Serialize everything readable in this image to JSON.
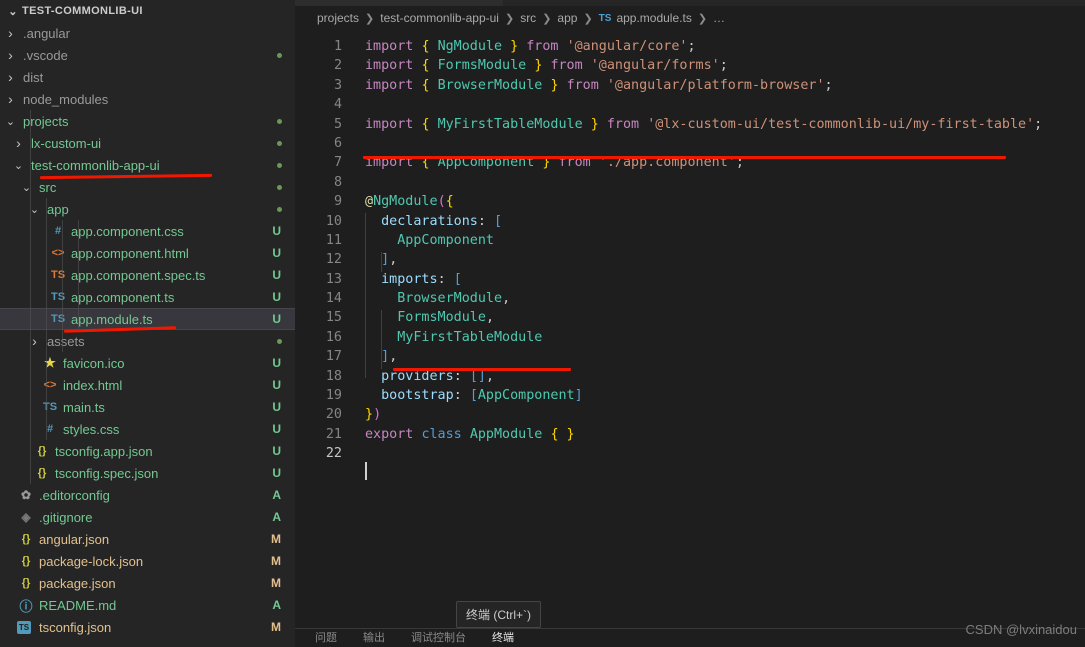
{
  "sidebar": {
    "title": "TEST-COMMONLIB-UI",
    "title_twisty": "chevron-down",
    "items": [
      {
        "label": ".angular",
        "icon": "folder",
        "twisty": "chevron-right",
        "indent": 1,
        "status": "",
        "dot": false,
        "color": "#9a9a9a"
      },
      {
        "label": ".vscode",
        "icon": "folder",
        "twisty": "chevron-right",
        "indent": 1,
        "status": "",
        "dot": true,
        "color": "#9a9a9a"
      },
      {
        "label": "dist",
        "icon": "folder",
        "twisty": "chevron-right",
        "indent": 1,
        "status": "",
        "dot": false,
        "color": "#9a9a9a"
      },
      {
        "label": "node_modules",
        "icon": "folder",
        "twisty": "chevron-right",
        "indent": 1,
        "status": "",
        "dot": false,
        "color": "#9a9a9a"
      },
      {
        "label": "projects",
        "icon": "folder",
        "twisty": "chevron-down",
        "indent": 1,
        "status": "",
        "dot": true,
        "color": "#73c991"
      },
      {
        "label": "lx-custom-ui",
        "icon": "folder",
        "twisty": "chevron-right",
        "indent": 2,
        "status": "",
        "dot": true,
        "color": "#73c991"
      },
      {
        "label": "test-commonlib-app-ui",
        "icon": "folder",
        "twisty": "chevron-down",
        "indent": 2,
        "status": "",
        "dot": true,
        "color": "#73c991"
      },
      {
        "label": "src",
        "icon": "folder",
        "twisty": "chevron-down",
        "indent": 3,
        "status": "",
        "dot": true,
        "color": "#73c991"
      },
      {
        "label": "app",
        "icon": "folder",
        "twisty": "chevron-down",
        "indent": 4,
        "status": "",
        "dot": true,
        "color": "#73c991"
      },
      {
        "label": "app.component.css",
        "icon": "css-icon",
        "icon_glyph": "#",
        "icon_color": "#519aba",
        "twisty": "none",
        "indent": 5,
        "status": "U",
        "dot": false,
        "color": "#73c991"
      },
      {
        "label": "app.component.html",
        "icon": "html-icon",
        "icon_glyph": "<>",
        "icon_color": "#e37933",
        "twisty": "none",
        "indent": 5,
        "status": "U",
        "dot": false,
        "color": "#73c991"
      },
      {
        "label": "app.component.spec.ts",
        "icon": "ts-test-icon",
        "icon_glyph": "TS",
        "icon_color": "#e37933",
        "twisty": "none",
        "indent": 5,
        "status": "U",
        "dot": false,
        "color": "#73c991"
      },
      {
        "label": "app.component.ts",
        "icon": "ts-icon",
        "icon_glyph": "TS",
        "icon_color": "#519aba",
        "twisty": "none",
        "indent": 5,
        "status": "U",
        "dot": false,
        "color": "#73c991"
      },
      {
        "label": "app.module.ts",
        "icon": "ts-icon",
        "icon_glyph": "TS",
        "icon_color": "#519aba",
        "twisty": "none",
        "indent": 5,
        "status": "U",
        "dot": false,
        "color": "#73c991",
        "selected": true
      },
      {
        "label": "assets",
        "icon": "folder",
        "twisty": "chevron-right",
        "indent": 4,
        "status": "",
        "dot": true,
        "color": "#9a9a9a"
      },
      {
        "label": "favicon.ico",
        "icon": "star-icon",
        "icon_glyph": "★",
        "icon_color": "#e6d54a",
        "twisty": "none",
        "indent": 4,
        "status": "U",
        "dot": false,
        "color": "#73c991"
      },
      {
        "label": "index.html",
        "icon": "html-icon",
        "icon_glyph": "<>",
        "icon_color": "#e37933",
        "twisty": "none",
        "indent": 4,
        "status": "U",
        "dot": false,
        "color": "#73c991"
      },
      {
        "label": "main.ts",
        "icon": "ts-icon",
        "icon_glyph": "TS",
        "icon_color": "#519aba",
        "twisty": "none",
        "indent": 4,
        "status": "U",
        "dot": false,
        "color": "#73c991"
      },
      {
        "label": "styles.css",
        "icon": "css-icon",
        "icon_glyph": "#",
        "icon_color": "#519aba",
        "twisty": "none",
        "indent": 4,
        "status": "U",
        "dot": false,
        "color": "#73c991"
      },
      {
        "label": "tsconfig.app.json",
        "icon": "json-icon",
        "icon_glyph": "{}",
        "icon_color": "#cbcb41",
        "twisty": "none",
        "indent": 3,
        "status": "U",
        "dot": false,
        "color": "#73c991"
      },
      {
        "label": "tsconfig.spec.json",
        "icon": "json-icon",
        "icon_glyph": "{}",
        "icon_color": "#cbcb41",
        "twisty": "none",
        "indent": 3,
        "status": "U",
        "dot": false,
        "color": "#73c991"
      },
      {
        "label": ".editorconfig",
        "icon": "gear-icon",
        "icon_glyph": "✿",
        "icon_color": "#9a9a9a",
        "twisty": "none",
        "indent": 1,
        "status": "A",
        "dot": false,
        "color": "#73c991"
      },
      {
        "label": ".gitignore",
        "icon": "git-icon",
        "icon_glyph": "◈",
        "icon_color": "#7a7a7a",
        "twisty": "none",
        "indent": 1,
        "status": "A",
        "dot": false,
        "color": "#73c991"
      },
      {
        "label": "angular.json",
        "icon": "json-icon",
        "icon_glyph": "{}",
        "icon_color": "#cbcb41",
        "twisty": "none",
        "indent": 1,
        "status": "M",
        "dot": false,
        "color": "#e2c08d"
      },
      {
        "label": "package-lock.json",
        "icon": "json-icon",
        "icon_glyph": "{}",
        "icon_color": "#cbcb41",
        "twisty": "none",
        "indent": 1,
        "status": "M",
        "dot": false,
        "color": "#e2c08d"
      },
      {
        "label": "package.json",
        "icon": "json-icon",
        "icon_glyph": "{}",
        "icon_color": "#cbcb41",
        "twisty": "none",
        "indent": 1,
        "status": "M",
        "dot": false,
        "color": "#e2c08d"
      },
      {
        "label": "README.md",
        "icon": "info-icon",
        "icon_glyph": "ⓘ",
        "icon_color": "#519aba",
        "twisty": "none",
        "indent": 1,
        "status": "A",
        "dot": false,
        "color": "#73c991"
      },
      {
        "label": "tsconfig.json",
        "icon": "tsconfig-icon",
        "icon_glyph": "TS",
        "icon_color": "#519aba",
        "twisty": "none",
        "indent": 1,
        "status": "M",
        "dot": false,
        "color": "#e2c08d"
      }
    ],
    "status_colors": {
      "U": "#73c991",
      "A": "#73c991",
      "M": "#e2c08d"
    }
  },
  "breadcrumb": {
    "items": [
      "projects",
      "test-commonlib-app-ui",
      "src",
      "app",
      "app.module.ts",
      "…"
    ],
    "file_icon": "TS",
    "separator": "❯"
  },
  "editor": {
    "file": "app.module.ts",
    "active_line": 22,
    "lines": [
      {
        "n": 1,
        "tokens": [
          {
            "t": "import",
            "c": "kw"
          },
          {
            "t": " ",
            "c": "punc"
          },
          {
            "t": "{",
            "c": "br"
          },
          {
            "t": " ",
            "c": "punc"
          },
          {
            "t": "NgModule",
            "c": "type"
          },
          {
            "t": " ",
            "c": "punc"
          },
          {
            "t": "}",
            "c": "br"
          },
          {
            "t": " ",
            "c": "punc"
          },
          {
            "t": "from",
            "c": "kw"
          },
          {
            "t": " ",
            "c": "punc"
          },
          {
            "t": "'@angular/core'",
            "c": "str"
          },
          {
            "t": ";",
            "c": "punc"
          }
        ]
      },
      {
        "n": 2,
        "tokens": [
          {
            "t": "import",
            "c": "kw"
          },
          {
            "t": " ",
            "c": "punc"
          },
          {
            "t": "{",
            "c": "br"
          },
          {
            "t": " ",
            "c": "punc"
          },
          {
            "t": "FormsModule",
            "c": "type"
          },
          {
            "t": " ",
            "c": "punc"
          },
          {
            "t": "}",
            "c": "br"
          },
          {
            "t": " ",
            "c": "punc"
          },
          {
            "t": "from",
            "c": "kw"
          },
          {
            "t": " ",
            "c": "punc"
          },
          {
            "t": "'@angular/forms'",
            "c": "str"
          },
          {
            "t": ";",
            "c": "punc"
          }
        ]
      },
      {
        "n": 3,
        "tokens": [
          {
            "t": "import",
            "c": "kw"
          },
          {
            "t": " ",
            "c": "punc"
          },
          {
            "t": "{",
            "c": "br"
          },
          {
            "t": " ",
            "c": "punc"
          },
          {
            "t": "BrowserModule",
            "c": "type"
          },
          {
            "t": " ",
            "c": "punc"
          },
          {
            "t": "}",
            "c": "br"
          },
          {
            "t": " ",
            "c": "punc"
          },
          {
            "t": "from",
            "c": "kw"
          },
          {
            "t": " ",
            "c": "punc"
          },
          {
            "t": "'@angular/platform-browser'",
            "c": "str"
          },
          {
            "t": ";",
            "c": "punc"
          }
        ]
      },
      {
        "n": 4,
        "tokens": []
      },
      {
        "n": 5,
        "tokens": [
          {
            "t": "import",
            "c": "kw"
          },
          {
            "t": " ",
            "c": "punc"
          },
          {
            "t": "{",
            "c": "br"
          },
          {
            "t": " ",
            "c": "punc"
          },
          {
            "t": "MyFirstTableModule",
            "c": "type"
          },
          {
            "t": " ",
            "c": "punc"
          },
          {
            "t": "}",
            "c": "br"
          },
          {
            "t": " ",
            "c": "punc"
          },
          {
            "t": "from",
            "c": "kw"
          },
          {
            "t": " ",
            "c": "punc"
          },
          {
            "t": "'@lx-custom-ui/test-commonlib-ui/my-first-table'",
            "c": "str"
          },
          {
            "t": ";",
            "c": "punc"
          }
        ]
      },
      {
        "n": 6,
        "tokens": []
      },
      {
        "n": 7,
        "tokens": [
          {
            "t": "import",
            "c": "kw"
          },
          {
            "t": " ",
            "c": "punc"
          },
          {
            "t": "{",
            "c": "br"
          },
          {
            "t": " ",
            "c": "punc"
          },
          {
            "t": "AppComponent",
            "c": "type"
          },
          {
            "t": " ",
            "c": "punc"
          },
          {
            "t": "}",
            "c": "br"
          },
          {
            "t": " ",
            "c": "punc"
          },
          {
            "t": "from",
            "c": "kw"
          },
          {
            "t": " ",
            "c": "punc"
          },
          {
            "t": "'./app.component'",
            "c": "str"
          },
          {
            "t": ";",
            "c": "punc"
          }
        ]
      },
      {
        "n": 8,
        "tokens": []
      },
      {
        "n": 9,
        "tokens": [
          {
            "t": "@",
            "c": "deco"
          },
          {
            "t": "NgModule",
            "c": "type"
          },
          {
            "t": "(",
            "c": "paren"
          },
          {
            "t": "{",
            "c": "br"
          }
        ]
      },
      {
        "n": 10,
        "tokens": [
          {
            "t": "  ",
            "c": "punc"
          },
          {
            "t": "declarations",
            "c": "prop"
          },
          {
            "t": ": ",
            "c": "punc"
          },
          {
            "t": "[",
            "c": "brk"
          }
        ]
      },
      {
        "n": 11,
        "tokens": [
          {
            "t": "    ",
            "c": "punc"
          },
          {
            "t": "AppComponent",
            "c": "type"
          }
        ]
      },
      {
        "n": 12,
        "tokens": [
          {
            "t": "  ",
            "c": "punc"
          },
          {
            "t": "]",
            "c": "brk"
          },
          {
            "t": ",",
            "c": "punc"
          }
        ]
      },
      {
        "n": 13,
        "tokens": [
          {
            "t": "  ",
            "c": "punc"
          },
          {
            "t": "imports",
            "c": "prop"
          },
          {
            "t": ": ",
            "c": "punc"
          },
          {
            "t": "[",
            "c": "brk"
          }
        ]
      },
      {
        "n": 14,
        "tokens": [
          {
            "t": "    ",
            "c": "punc"
          },
          {
            "t": "BrowserModule",
            "c": "type"
          },
          {
            "t": ",",
            "c": "punc"
          }
        ]
      },
      {
        "n": 15,
        "tokens": [
          {
            "t": "    ",
            "c": "punc"
          },
          {
            "t": "FormsModule",
            "c": "type"
          },
          {
            "t": ",",
            "c": "punc"
          }
        ]
      },
      {
        "n": 16,
        "tokens": [
          {
            "t": "    ",
            "c": "punc"
          },
          {
            "t": "MyFirstTableModule",
            "c": "type"
          }
        ]
      },
      {
        "n": 17,
        "tokens": [
          {
            "t": "  ",
            "c": "punc"
          },
          {
            "t": "]",
            "c": "brk"
          },
          {
            "t": ",",
            "c": "punc"
          }
        ]
      },
      {
        "n": 18,
        "tokens": [
          {
            "t": "  ",
            "c": "punc"
          },
          {
            "t": "providers",
            "c": "prop"
          },
          {
            "t": ": ",
            "c": "punc"
          },
          {
            "t": "[]",
            "c": "brk"
          },
          {
            "t": ",",
            "c": "punc"
          }
        ]
      },
      {
        "n": 19,
        "tokens": [
          {
            "t": "  ",
            "c": "punc"
          },
          {
            "t": "bootstrap",
            "c": "prop"
          },
          {
            "t": ": ",
            "c": "punc"
          },
          {
            "t": "[",
            "c": "brk"
          },
          {
            "t": "AppComponent",
            "c": "type"
          },
          {
            "t": "]",
            "c": "brk"
          }
        ]
      },
      {
        "n": 20,
        "tokens": [
          {
            "t": "}",
            "c": "br"
          },
          {
            "t": ")",
            "c": "paren"
          }
        ]
      },
      {
        "n": 21,
        "tokens": [
          {
            "t": "export",
            "c": "kw"
          },
          {
            "t": " ",
            "c": "punc"
          },
          {
            "t": "class",
            "c": "kw2"
          },
          {
            "t": " ",
            "c": "punc"
          },
          {
            "t": "AppModule",
            "c": "type"
          },
          {
            "t": " ",
            "c": "punc"
          },
          {
            "t": "{ }",
            "c": "br"
          }
        ]
      },
      {
        "n": 22,
        "tokens": []
      }
    ]
  },
  "annotations": {
    "color": "#f01800",
    "underlines": [
      {
        "name": "sidebar-folder-underline"
      },
      {
        "name": "sidebar-file-underline"
      },
      {
        "name": "code-import-underline"
      },
      {
        "name": "code-module-underline"
      }
    ]
  },
  "tooltip": {
    "text": "终端 (Ctrl+`)"
  },
  "panel": {
    "tabs": [
      {
        "label": "问题",
        "active": false
      },
      {
        "label": "输出",
        "active": false
      },
      {
        "label": "调试控制台",
        "active": false
      },
      {
        "label": "终端",
        "active": true
      }
    ]
  },
  "watermark": {
    "text": "CSDN @lvxinaidou"
  }
}
